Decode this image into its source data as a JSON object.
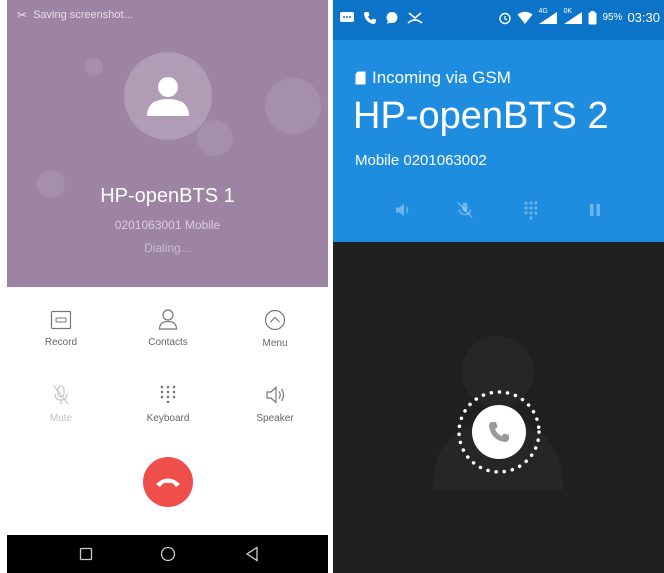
{
  "left_phone": {
    "notification": "Saving screenshot...",
    "caller": {
      "name": "HP-openBTS 1",
      "number_line": "0201063001 Mobile",
      "status": "Dialing..."
    },
    "actions": [
      {
        "label": "Record",
        "icon": "record-icon",
        "enabled": true
      },
      {
        "label": "Contacts",
        "icon": "contacts-icon",
        "enabled": true
      },
      {
        "label": "Menu",
        "icon": "menu-icon",
        "enabled": true
      },
      {
        "label": "Mute",
        "icon": "mute-icon",
        "enabled": false
      },
      {
        "label": "Keyboard",
        "icon": "keypad-icon",
        "enabled": true
      },
      {
        "label": "Speaker",
        "icon": "speaker-icon",
        "enabled": true
      }
    ],
    "end_call_color": "#ef4e4b",
    "header_color": "#9d84a3"
  },
  "right_phone": {
    "status_bar": {
      "network_labels": [
        "4G",
        "0K"
      ],
      "battery": "95%",
      "clock": "03:30"
    },
    "incoming_label": "Incoming via GSM",
    "caller_name": "HP-openBTS 2",
    "caller_line": "Mobile 0201063002",
    "header_color": "#1e8de0",
    "status_bar_color": "#0b73c8"
  }
}
